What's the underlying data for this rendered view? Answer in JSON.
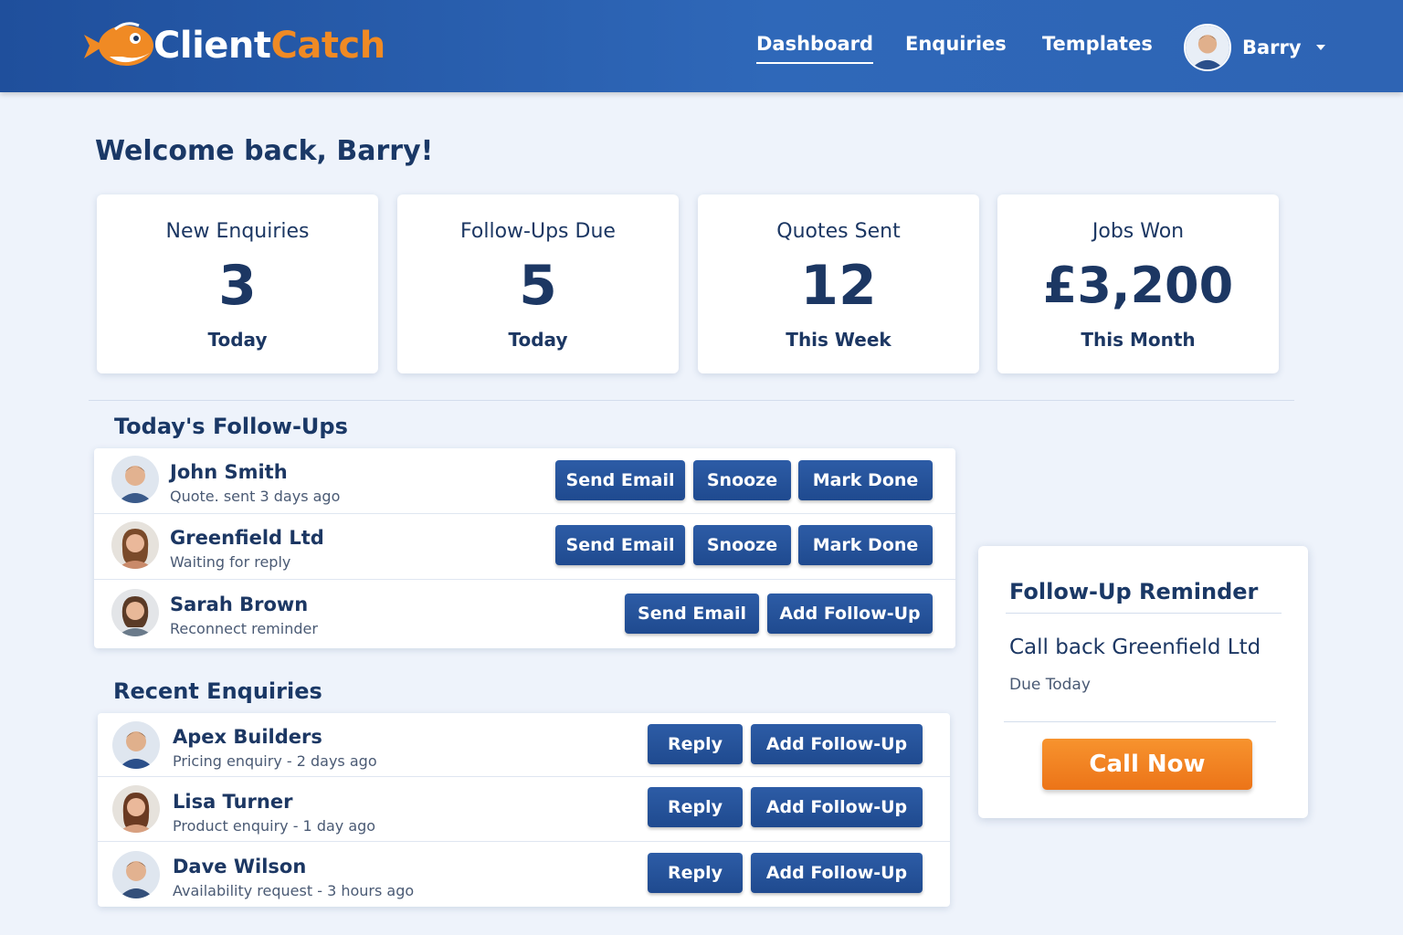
{
  "app": {
    "logo_part1": "Client",
    "logo_part2": "Catch"
  },
  "nav": {
    "items": [
      {
        "label": "Dashboard",
        "active": true
      },
      {
        "label": "Enquiries",
        "active": false
      },
      {
        "label": "Templates",
        "active": false
      }
    ]
  },
  "user": {
    "name": "Barry"
  },
  "welcome": "Welcome back, Barry!",
  "stats": [
    {
      "label": "New Enquiries",
      "value": "3",
      "period": "Today"
    },
    {
      "label": "Follow-Ups Due",
      "value": "5",
      "period": "Today"
    },
    {
      "label": "Quotes Sent",
      "value": "12",
      "period": "This Week"
    },
    {
      "label": "Jobs Won",
      "value": "£3,200",
      "period": "This Month"
    }
  ],
  "followups": {
    "title": "Today's Follow-Ups",
    "rows": [
      {
        "name": "John Smith",
        "sub": "Quote. sent 3 days ago",
        "buttons": [
          "Send Email",
          "Snooze",
          "Mark Done"
        ]
      },
      {
        "name": "Greenfield Ltd",
        "sub": "Waiting for reply",
        "buttons": [
          "Send Email",
          "Snooze",
          "Mark Done"
        ]
      },
      {
        "name": "Sarah Brown",
        "sub": "Reconnect reminder",
        "buttons": [
          "Send Email",
          "Add Follow-Up"
        ]
      }
    ]
  },
  "enquiries": {
    "title": "Recent Enquiries",
    "rows": [
      {
        "name": "Apex Builders",
        "sub": "Pricing enquiry - 2 days ago",
        "buttons": [
          "Reply",
          "Add Follow-Up"
        ]
      },
      {
        "name": "Lisa Turner",
        "sub": "Product enquiry - 1 day ago",
        "buttons": [
          "Reply",
          "Add Follow-Up"
        ]
      },
      {
        "name": "Dave Wilson",
        "sub": "Availability request - 3 hours ago",
        "buttons": [
          "Reply",
          "Add Follow-Up"
        ]
      }
    ]
  },
  "reminder": {
    "title": "Follow-Up Reminder",
    "text": "Call back Greenfield Ltd",
    "due": "Due Today",
    "button": "Call Now"
  },
  "colors": {
    "primary": "#1f4a8f",
    "header": "#2f68b9",
    "accent": "#f08a24",
    "background": "#eef3fb"
  }
}
